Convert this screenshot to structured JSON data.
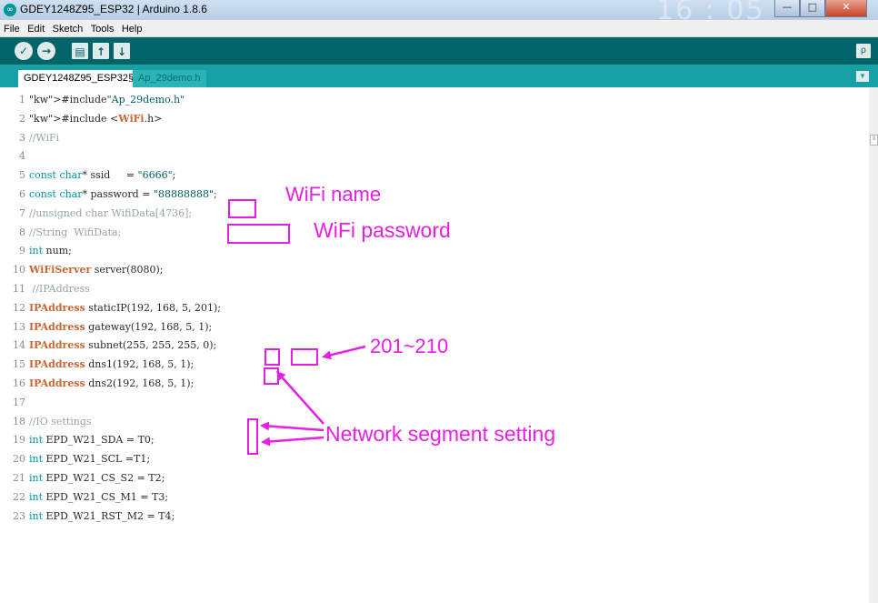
{
  "window": {
    "title": "GDEY1248Z95_ESP32 | Arduino 1.8.6",
    "app_icon": "arduino-icon",
    "clock_ghost": "16 : 05",
    "buttons": {
      "minimize": "—",
      "maximize": "□",
      "close": "✕"
    }
  },
  "menu": [
    "File",
    "Edit",
    "Sketch",
    "Tools",
    "Help"
  ],
  "toolbar": {
    "buttons": [
      "verify-icon",
      "upload-icon",
      "new-icon",
      "open-icon",
      "save-icon"
    ],
    "serial_monitor": "serial-monitor-icon"
  },
  "tabs": [
    {
      "label": "GDEY1248Z95_ESP32§",
      "active": true
    },
    {
      "label": "Ap_29demo.h",
      "active": false
    }
  ],
  "code_lines": [
    {
      "num": "1",
      "text": "#include\"Ap_29demo.h\""
    },
    {
      "num": "2",
      "text": "#include <WiFi.h>"
    },
    {
      "num": "3",
      "text": "//WiFi"
    },
    {
      "num": "4",
      "text": ""
    },
    {
      "num": "5",
      "text": "const char* ssid     = \"6666\";"
    },
    {
      "num": "6",
      "text": "const char* password = \"88888888\";"
    },
    {
      "num": "7",
      "text": "//unsigned char WifiData[4736];"
    },
    {
      "num": "8",
      "text": "//String  WifiData;"
    },
    {
      "num": "9",
      "text": "int num;"
    },
    {
      "num": "10",
      "text": "WiFiServer server(8080);"
    },
    {
      "num": "11",
      "text": " //IPAddress"
    },
    {
      "num": "12",
      "text": "IPAddress staticIP(192, 168, 5, 201);"
    },
    {
      "num": "13",
      "text": "IPAddress gateway(192, 168, 5, 1);"
    },
    {
      "num": "14",
      "text": "IPAddress subnet(255, 255, 255, 0);"
    },
    {
      "num": "15",
      "text": "IPAddress dns1(192, 168, 5, 1);"
    },
    {
      "num": "16",
      "text": "IPAddress dns2(192, 168, 5, 1);"
    },
    {
      "num": "17",
      "text": ""
    },
    {
      "num": "18",
      "text": "//IO settings"
    },
    {
      "num": "19",
      "text": "int EPD_W21_SDA = T0;"
    },
    {
      "num": "20",
      "text": "int EPD_W21_SCL =T1;"
    },
    {
      "num": "21",
      "text": "int EPD_W21_CS_S2 = T2;"
    },
    {
      "num": "22",
      "text": "int EPD_W21_CS_M1 = T3;"
    },
    {
      "num": "23",
      "text": "int EPD_W21_RST_M2 = T4;"
    }
  ],
  "annotations": {
    "wifi_name": "WiFi name",
    "wifi_password": "WiFi password",
    "ip_range": "201~210",
    "network_segment": "Network segment setting"
  },
  "colors": {
    "toolbar": "#006468",
    "tabbar": "#17a1a5",
    "keyword": "#00979c",
    "type": "#cc6633",
    "annotation": "#e61ee6"
  }
}
